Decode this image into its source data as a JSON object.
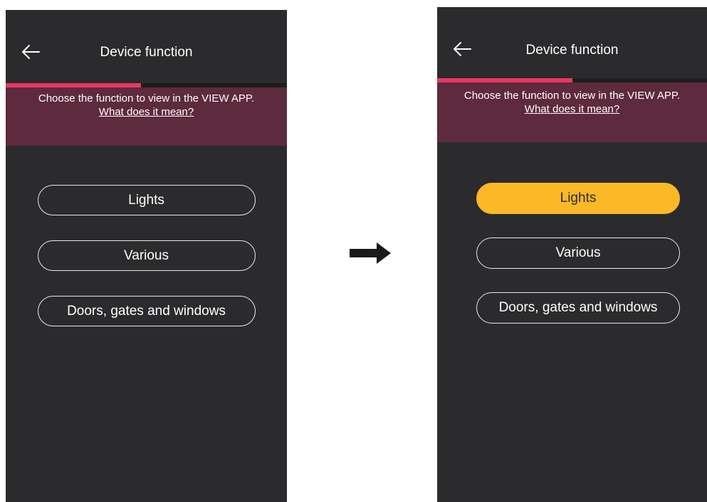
{
  "screens": [
    {
      "title": "Device function",
      "progress": 0.48,
      "banner": {
        "text": "Choose the function to view in the VIEW APP.",
        "link": "What does it mean?"
      },
      "options": [
        {
          "label": "Lights",
          "selected": false
        },
        {
          "label": "Various",
          "selected": false
        },
        {
          "label": "Doors, gates and windows",
          "selected": false
        }
      ]
    },
    {
      "title": "Device function",
      "progress": 0.5,
      "banner": {
        "text": "Choose the function to view in the VIEW APP.",
        "link": "What does it mean?"
      },
      "options": [
        {
          "label": "Lights",
          "selected": true
        },
        {
          "label": "Various",
          "selected": false
        },
        {
          "label": "Doors, gates and windows",
          "selected": false
        }
      ]
    }
  ],
  "icons": {
    "back": "arrow-left-icon",
    "transition": "arrow-right-icon"
  },
  "colors": {
    "screen_bg": "#2b2b2d",
    "progress": "#e8375f",
    "banner_bg": "#5e2a3d",
    "selected": "#fbb827"
  }
}
